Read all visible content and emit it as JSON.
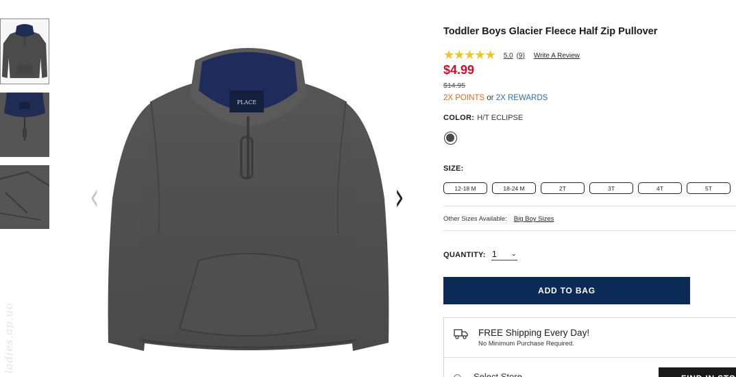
{
  "product": {
    "title": "Toddler Boys Glacier Fleece Half Zip Pullover",
    "rating_stars": "★★★★★",
    "rating_value": "5.0",
    "rating_count": "(9)",
    "write_review": "Write A Review",
    "price": "$4.99",
    "original_price": "$14.95",
    "points": {
      "points_text": "2X POINTS",
      "or_text": " or ",
      "rewards_text": "2X REWARDS"
    },
    "color": {
      "label": "COLOR:",
      "value": "H/T ECLIPSE",
      "swatch_color": "#4a4a4a"
    },
    "size": {
      "label": "SIZE:",
      "options": [
        "12-18 M",
        "18-24 M",
        "2T",
        "3T",
        "4T",
        "5T"
      ]
    },
    "other_sizes": {
      "label": "Other Sizes Available:",
      "link": "Big Boy Sizes"
    },
    "quantity": {
      "label": "QUANTITY:",
      "value": "1"
    },
    "add_to_bag": "ADD TO BAG",
    "shipping": {
      "title": "FREE Shipping Every Day!",
      "subtitle": "No Minimum Purchase Required."
    },
    "store": {
      "label": "Select Store",
      "button": "FIND IN STORE"
    },
    "logo_text": "PLACE"
  },
  "gallery": {
    "prev_icon": "‹",
    "next_icon": "›",
    "icons": [
      "chevron-left-icon",
      "chevron-right-icon",
      "shipping-truck-icon",
      "star-icon"
    ]
  },
  "watermark": "ladies.ap.uo",
  "colors": {
    "accent_navy": "#0b2a55",
    "price_red": "#c8102e",
    "points_orange": "#e06a1d",
    "rewards_blue": "#2c6ea8",
    "star_yellow": "#f2c12e"
  }
}
